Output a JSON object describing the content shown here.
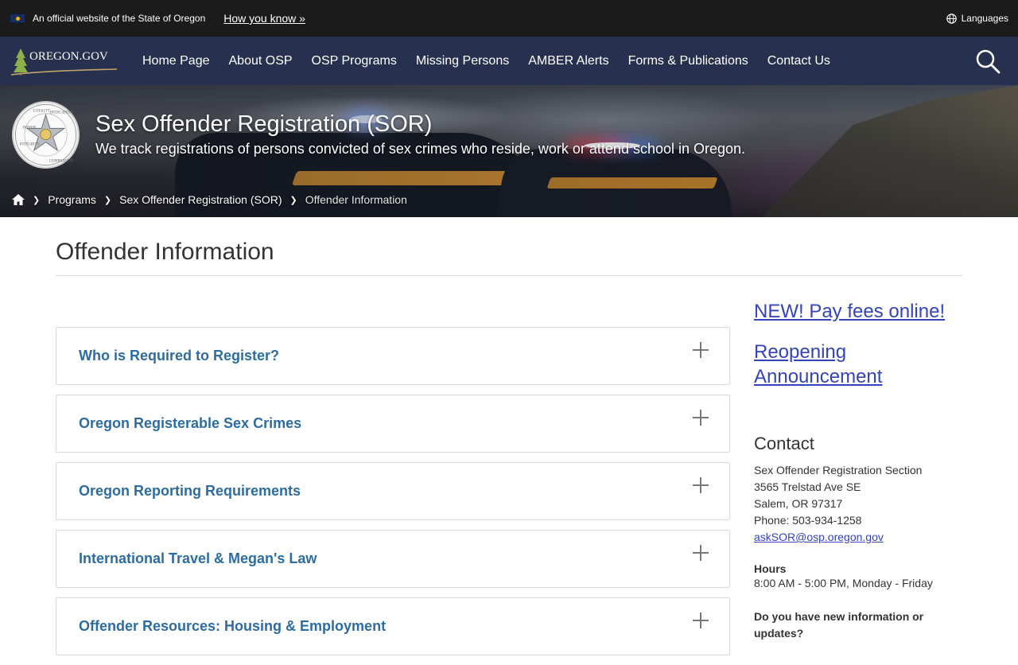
{
  "gov_banner": {
    "official_text": "An official website of the State of Oregon",
    "how_you_know": "How you know »",
    "languages": "Languages"
  },
  "nav": {
    "logo_text": "OREGON.GOV",
    "items": [
      "Home Page",
      "About OSP",
      "OSP Programs",
      "Missing Persons",
      "AMBER Alerts",
      "Forms & Publications",
      "Contact Us"
    ]
  },
  "hero": {
    "title": "Sex Offender Registration (SOR)",
    "subtitle": "We track registrations of persons convicted of sex crimes who reside, work or attend school in Oregon.",
    "seal_words": [
      "HONOR",
      "LOYALTY",
      "DEDICATION",
      "INTEGRITY",
      "COMPASSION"
    ]
  },
  "breadcrumb": {
    "items": [
      "Programs",
      "Sex Offender Registration (SOR)"
    ],
    "current": "Offender Information"
  },
  "page": {
    "title": "Offender Information"
  },
  "accordion": {
    "items": [
      "Who is Required to Register?",
      "Oregon Registerable Sex Crimes",
      "Oregon Reporting Requirements",
      "International Travel & Megan's Law",
      "Offender Resources: Housing & Employment"
    ]
  },
  "sidebar": {
    "link1": "NEW! Pay fees online!",
    "link2": "Reopening Announcement",
    "contact_heading": "Contact",
    "contact_lines": [
      "Sex Offender Registration Section",
      "3565 Trelstad Ave SE",
      "Salem, OR 97317",
      "Phone: 503-934-1258"
    ],
    "email": "askSOR@osp.oregon.gov",
    "hours_heading": "Hours",
    "hours": "8:00 AM - 5:00 PM, Monday - Friday",
    "question": "Do you have new information or updates?"
  },
  "colors": {
    "banner_bg": "#1b1b1b",
    "nav_bg": "#27314f",
    "accordion_text": "#2d6ca2",
    "link": "#3344bb"
  },
  "icons": [
    "flag-icon",
    "globe-icon",
    "search-icon",
    "home-icon",
    "chevron-right-icon",
    "plus-icon"
  ]
}
